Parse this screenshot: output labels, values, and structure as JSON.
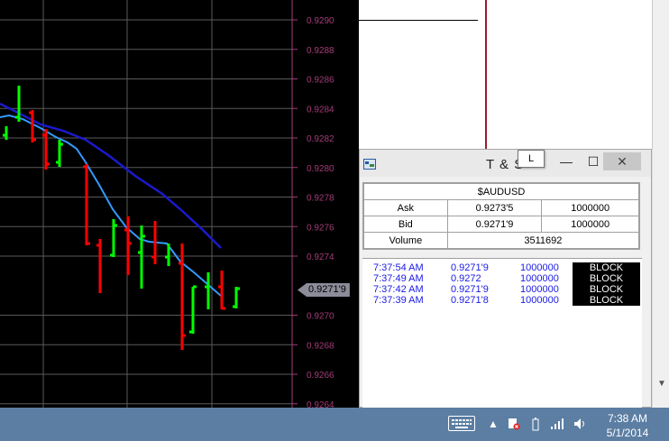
{
  "chart": {
    "y_ticks": [
      "0.9290",
      "0.9288",
      "0.9286",
      "0.9284",
      "0.9282",
      "0.9280",
      "0.9278",
      "0.9276",
      "0.9274",
      "0.9270",
      "0.9268",
      "0.9266",
      "0.9264"
    ],
    "last_price_label": "0.9271'9",
    "colors": {
      "up": "#00ff00",
      "down": "#ff0000",
      "ma_fast": "#3399ff",
      "ma_slow": "#1a1acc",
      "axis": "#a23c78",
      "grid": "#5a5a5a"
    }
  },
  "ts_window": {
    "title": "T & S",
    "tooltip": "L",
    "buttons": {
      "minimize": "—",
      "maximize": "☐",
      "close": "✕"
    },
    "symbol": "$AUDUSD",
    "quote": {
      "ask_label": "Ask",
      "ask_price": "0.9273'5",
      "ask_size": "1000000",
      "bid_label": "Bid",
      "bid_price": "0.9271'9",
      "bid_size": "1000000",
      "volume_label": "Volume",
      "volume": "3511692"
    },
    "trades": [
      {
        "time": "7:37:54 AM",
        "price": "0.9271'9",
        "size": "1000000",
        "cond": "BLOCK"
      },
      {
        "time": "7:37:49 AM",
        "price": "0.9272",
        "size": "1000000",
        "cond": "BLOCK"
      },
      {
        "time": "7:37:42 AM",
        "price": "0.9271'9",
        "size": "1000000",
        "cond": "BLOCK"
      },
      {
        "time": "7:37:39 AM",
        "price": "0.9271'8",
        "size": "1000000",
        "cond": "BLOCK"
      }
    ]
  },
  "taskbar": {
    "time": "7:38 AM",
    "date": "5/1/2014"
  }
}
